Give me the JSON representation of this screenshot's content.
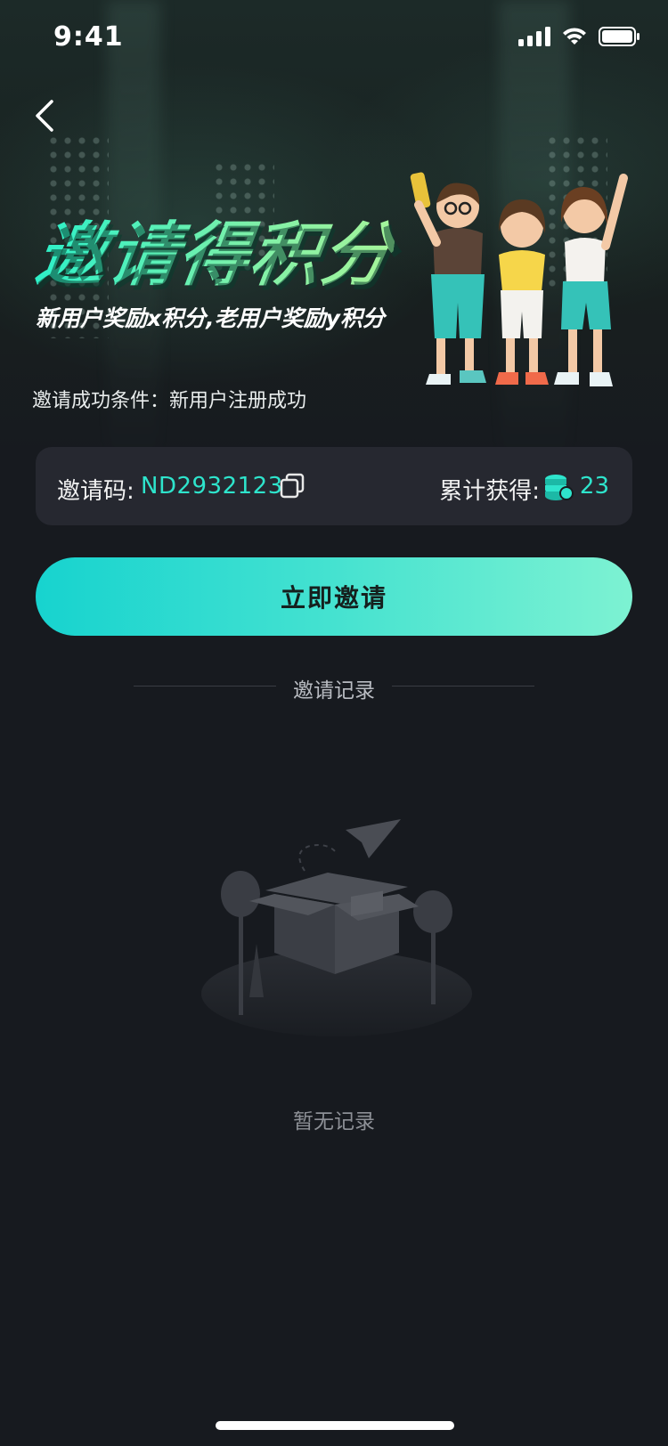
{
  "status_bar": {
    "time": "9:41"
  },
  "hero": {
    "title": "邀请得积分",
    "subtitle": "新用户奖励x积分,老用户奖励y积分",
    "condition": "邀请成功条件：新用户注册成功"
  },
  "invite_card": {
    "code_label": "邀请码:",
    "code_value": "ND2932123",
    "total_label": "累计获得:",
    "total_value": "23"
  },
  "invite_button": {
    "label": "立即邀请"
  },
  "records": {
    "title": "邀请记录",
    "empty_text": "暂无记录"
  },
  "colors": {
    "accent": "#2ee4cc",
    "button_start": "#17d3cf",
    "button_end": "#7df2d2",
    "background": "#171a1f",
    "card": "#262830"
  },
  "icons": [
    "back-icon",
    "copy-icon",
    "coin-stack-icon",
    "signal-icon",
    "wifi-icon",
    "battery-icon"
  ]
}
